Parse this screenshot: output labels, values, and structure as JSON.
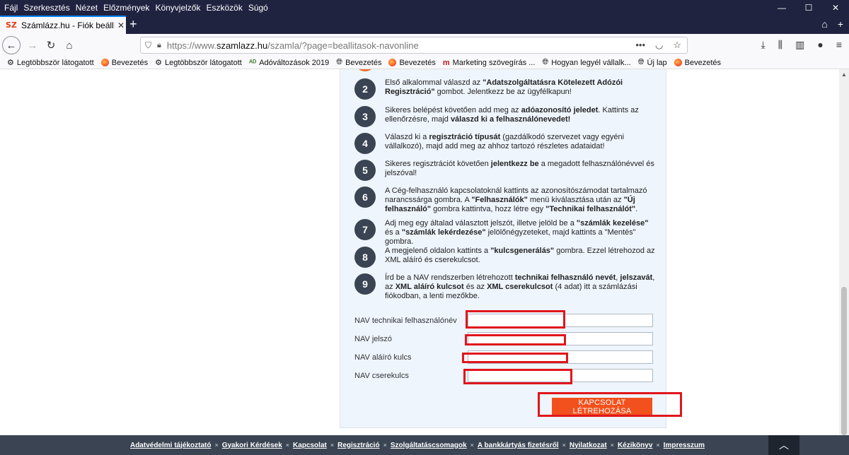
{
  "menu": [
    "Fájl",
    "Szerkesztés",
    "Nézet",
    "Előzmények",
    "Könyvjelzők",
    "Eszközök",
    "Súgó"
  ],
  "window_controls": {
    "minimize": "—",
    "maximize": "☐",
    "close": "✕"
  },
  "tab": {
    "favicon": "SZ",
    "title": "Számlázz.hu - Fiók beállítások",
    "close": "✕",
    "new": "+"
  },
  "navbar": {
    "url_prefix": "https://www.",
    "url_domain": "szamlazz.hu",
    "url_path": "/szamla/?page=beallitasok-navonline",
    "url_more": "•••"
  },
  "bookmarks": [
    {
      "icon": "gear-icon",
      "label": "Legtöbbször látogatott"
    },
    {
      "icon": "firefox-icon",
      "label": "Bevezetés"
    },
    {
      "icon": "gear-icon",
      "label": "Legtöbbször látogatott"
    },
    {
      "icon": "tax-icon",
      "label": "Adóváltozások 2019"
    },
    {
      "icon": "globe-icon",
      "label": "Bevezetés"
    },
    {
      "icon": "firefox-icon",
      "label": "Bevezetés"
    },
    {
      "icon": "m-icon",
      "label": "Marketing szövegírás ..."
    },
    {
      "icon": "globe-icon",
      "label": "Hogyan legyél vállalk..."
    },
    {
      "icon": "globe-icon",
      "label": "Új lap"
    },
    {
      "icon": "firefox-icon",
      "label": "Bevezetés"
    }
  ],
  "steps": [
    {
      "num": "2",
      "parts": [
        [
          "Első alkalommal válaszd az ",
          false
        ],
        [
          "\"Adatszolgáltatásra Kötelezett Adózói Regisztráció\"",
          true
        ],
        [
          " gombot. Jelentkezz be az ügyfélkapun!",
          false
        ]
      ]
    },
    {
      "num": "3",
      "parts": [
        [
          "Sikeres belépést követően add meg az ",
          false
        ],
        [
          "adóazonosító jeledet",
          true
        ],
        [
          ". Kattints az ellenőrzésre, majd ",
          false
        ],
        [
          "válaszd ki a felhasználónevedet!",
          true
        ]
      ]
    },
    {
      "num": "4",
      "parts": [
        [
          "Válaszd ki a ",
          false
        ],
        [
          "regisztráció típusát",
          true
        ],
        [
          " (gazdálkodó szervezet vagy egyéni vállalkozó), majd add meg az ahhoz tartozó részletes adataidat!",
          false
        ]
      ]
    },
    {
      "num": "5",
      "parts": [
        [
          "Sikeres regisztrációt követően ",
          false
        ],
        [
          "jelentkezz be",
          true
        ],
        [
          " a megadott felhasználónévvel és jelszóval!",
          false
        ]
      ]
    },
    {
      "num": "6",
      "parts": [
        [
          "A Cég-felhasználó kapcsolatoknál kattints az azonosítószámodat tartalmazó narancssárga gombra. A ",
          false
        ],
        [
          "\"Felhasználók\"",
          true
        ],
        [
          " menü kiválasztása után az ",
          false
        ],
        [
          "\"Új felhasználó\"",
          true
        ],
        [
          " gombra kattintva, hozz létre egy ",
          false
        ],
        [
          "\"Technikai felhasználót\"",
          true
        ],
        [
          ".",
          false
        ]
      ]
    },
    {
      "num": "7",
      "parts": [
        [
          "Adj meg egy általad választott jelszót, illetve jelöld be a ",
          false
        ],
        [
          "\"számlák kezelése\"",
          true
        ],
        [
          " és a ",
          false
        ],
        [
          "\"számlák lekérdezése\"",
          true
        ],
        [
          " jelölőnégyzeteket, majd kattints a \"Mentés\" gombra.",
          false
        ]
      ]
    },
    {
      "num": "8",
      "parts": [
        [
          "A megjelenő oldalon kattints a ",
          false
        ],
        [
          "\"kulcsgenerálás\"",
          true
        ],
        [
          " gombra. Ezzel létrehozod az XML aláíró és cserekulcsot.",
          false
        ]
      ]
    },
    {
      "num": "9",
      "parts": [
        [
          "Írd be a NAV rendszerben létrehozott ",
          false
        ],
        [
          "technikai felhasználó nevét",
          true
        ],
        [
          ", ",
          false
        ],
        [
          "jelszavát",
          true
        ],
        [
          ", az ",
          false
        ],
        [
          "XML aláíró kulcsot",
          true
        ],
        [
          " és az ",
          false
        ],
        [
          "XML cserekulcsot",
          true
        ],
        [
          " (4 adat) itt a számlázási fiókodban, a lenti mezőkbe.",
          false
        ]
      ]
    }
  ],
  "form": {
    "fields": [
      {
        "label": "NAV technikai felhasználónév",
        "value": ""
      },
      {
        "label": "NAV jelszó",
        "value": ""
      },
      {
        "label": "NAV aláíró kulcs",
        "value": ""
      },
      {
        "label": "NAV cserekulcs",
        "value": ""
      }
    ],
    "submit_label": "KAPCSOLAT LÉTREHOZÁSA"
  },
  "footer": {
    "links": [
      "Adatvédelmi tájékoztató",
      "Gyakori Kérdések",
      "Kapcsolat",
      "Regisztráció",
      "Szolgáltatáscsomagok",
      "A bankkártyás fizetésről",
      "Nyilatkozat",
      "Kézikönyv",
      "Impresszum"
    ],
    "separator": "×",
    "to_top": "︿"
  },
  "colors": {
    "highlight": "#e0161c",
    "accent": "#f2501c",
    "dark": "#3a4452"
  }
}
